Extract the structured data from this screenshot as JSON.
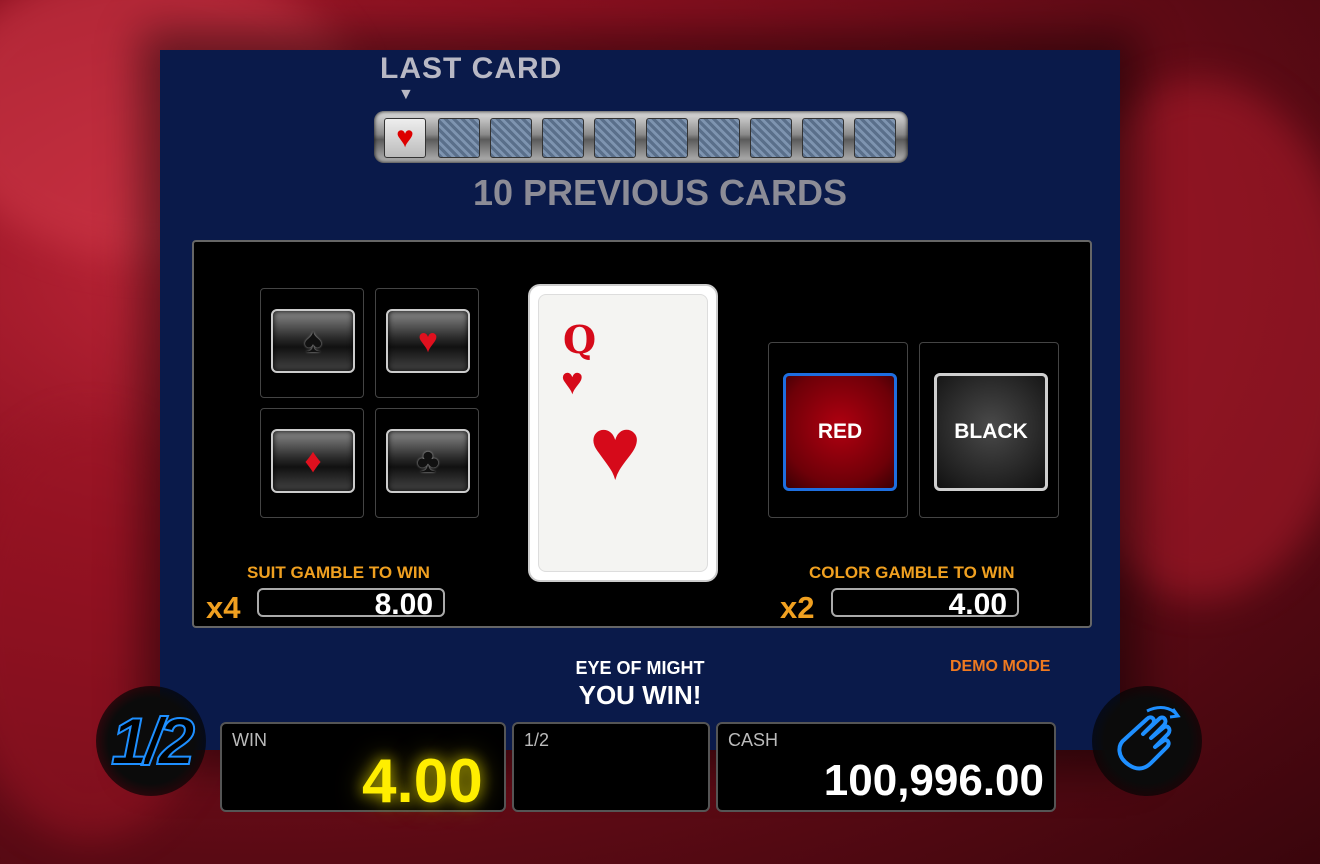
{
  "history": {
    "last_card_label": "LAST CARD",
    "previous_label": "10 PREVIOUS CARDS",
    "last_card_suit": "♥",
    "slots": [
      "heart",
      "back",
      "back",
      "back",
      "back",
      "back",
      "back",
      "back",
      "back",
      "back"
    ]
  },
  "suits": {
    "spade": "♠",
    "heart": "♥",
    "diamond": "♦",
    "club": "♣",
    "label": "SUIT GAMBLE TO WIN",
    "multiplier": "x4",
    "value": "8.00"
  },
  "card": {
    "rank": "Q",
    "suit": "♥"
  },
  "color": {
    "red_label": "RED",
    "black_label": "BLACK",
    "label": "COLOR GAMBLE TO WIN",
    "multiplier": "x2",
    "value": "4.00"
  },
  "status": {
    "game_name": "EYE OF MIGHT",
    "message": "YOU WIN!",
    "mode": "DEMO MODE"
  },
  "meters": {
    "win_label": "WIN",
    "win_value": "4.00",
    "half_label": "1/2",
    "cash_label": "CASH",
    "cash_value": "100,996.00"
  },
  "buttons": {
    "half_gamble": "1/2"
  },
  "colors": {
    "accent": "#f0a020",
    "win_yellow": "#ffee00",
    "blue": "#1e8fff",
    "red": "#d60a1a"
  }
}
